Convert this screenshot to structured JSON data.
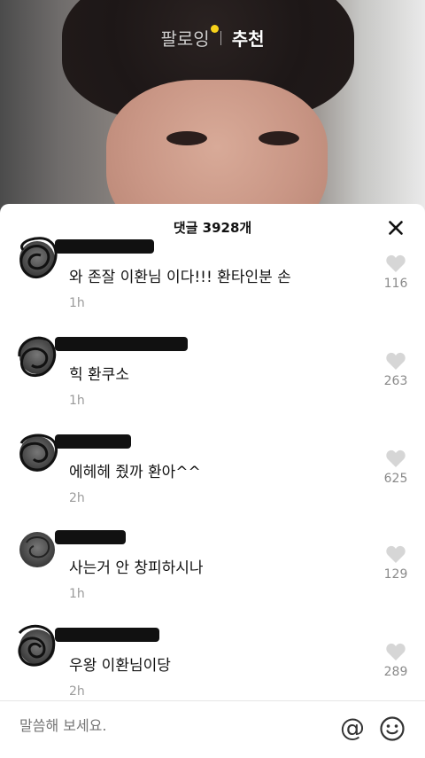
{
  "top_tabs": {
    "following": "팔로잉",
    "recommended": "추천",
    "accent_dot_color": "#f7d21a"
  },
  "comments_sheet": {
    "title": "댓글 3928개",
    "close_icon": "close-icon",
    "comments": [
      {
        "text": "와 존잘 이환님 이다!!! 환타인분 손",
        "time": "1h",
        "likes": "116"
      },
      {
        "text": "힉 환쿠소",
        "time": "1h",
        "likes": "263"
      },
      {
        "text": "에헤헤 줬까 환아^^",
        "time": "2h",
        "likes": "625"
      },
      {
        "text": "사는거 안 창피하시나",
        "time": "1h",
        "likes": "129"
      },
      {
        "text": "우왕 이환님이당",
        "time": "2h",
        "likes": "289"
      }
    ]
  },
  "input_bar": {
    "placeholder": "말씀해 보세요.",
    "mention_symbol": "@",
    "emoji_icon": "smiley-icon"
  }
}
